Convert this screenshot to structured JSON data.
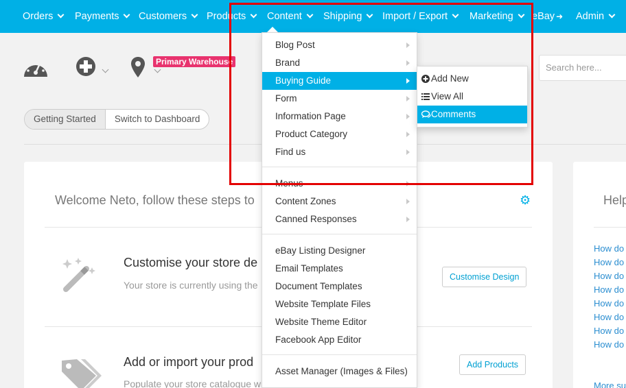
{
  "nav": {
    "items": [
      {
        "label": "Orders"
      },
      {
        "label": "Payments"
      },
      {
        "label": "Customers"
      },
      {
        "label": "Products"
      },
      {
        "label": "Content"
      },
      {
        "label": "Shipping"
      },
      {
        "label": "Import / Export"
      },
      {
        "label": "Marketing"
      },
      {
        "label": "eBay"
      },
      {
        "label": "Admin"
      }
    ]
  },
  "toolbar": {
    "warehouse_badge": "Primary Warehouse",
    "search_placeholder": "Search here..."
  },
  "view_toggle": {
    "getting_started": "Getting Started",
    "switch_dashboard": "Switch to Dashboard"
  },
  "main": {
    "welcome": "Welcome Neto, follow these steps to",
    "steps": [
      {
        "title": "Customise your store de",
        "desc": "Your store is currently using the",
        "button": "Customise Design"
      },
      {
        "title": "Add or import your prod",
        "desc": "Populate your store catalogue with products.",
        "button": "Add Products"
      }
    ]
  },
  "help": {
    "title": "Help",
    "links": [
      "How do",
      "How do",
      "How do",
      "How do",
      "How do",
      "How do",
      "How do",
      "How do"
    ],
    "more": "More su"
  },
  "content_menu": {
    "group1": [
      "Blog Post",
      "Brand",
      "Buying Guide",
      "Form",
      "Information Page",
      "Product Category",
      "Find us"
    ],
    "group2": [
      "Menus",
      "Content Zones",
      "Canned Responses"
    ],
    "group3": [
      "eBay Listing Designer",
      "Email Templates",
      "Document Templates",
      "Website Template Files",
      "Website Theme Editor",
      "Facebook App Editor"
    ],
    "group4": [
      "Asset Manager (Images & Files)"
    ]
  },
  "submenu": {
    "items": [
      {
        "label": "Add New",
        "icon": "plus-circle-icon"
      },
      {
        "label": "View All",
        "icon": "list-icon"
      },
      {
        "label": "Comments",
        "icon": "comments-icon"
      }
    ]
  },
  "colors": {
    "nav_bg": "#00b0e6",
    "highlight": "#00b0e6",
    "badge": "#e8336e",
    "annotation_box": "#e30000"
  }
}
